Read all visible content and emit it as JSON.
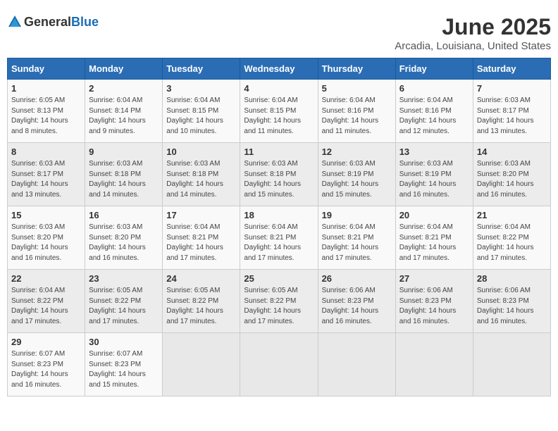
{
  "header": {
    "logo_general": "General",
    "logo_blue": "Blue",
    "main_title": "June 2025",
    "subtitle": "Arcadia, Louisiana, United States"
  },
  "calendar": {
    "columns": [
      "Sunday",
      "Monday",
      "Tuesday",
      "Wednesday",
      "Thursday",
      "Friday",
      "Saturday"
    ],
    "rows": [
      [
        {
          "day": "1",
          "info": "Sunrise: 6:05 AM\nSunset: 8:13 PM\nDaylight: 14 hours\nand 8 minutes."
        },
        {
          "day": "2",
          "info": "Sunrise: 6:04 AM\nSunset: 8:14 PM\nDaylight: 14 hours\nand 9 minutes."
        },
        {
          "day": "3",
          "info": "Sunrise: 6:04 AM\nSunset: 8:15 PM\nDaylight: 14 hours\nand 10 minutes."
        },
        {
          "day": "4",
          "info": "Sunrise: 6:04 AM\nSunset: 8:15 PM\nDaylight: 14 hours\nand 11 minutes."
        },
        {
          "day": "5",
          "info": "Sunrise: 6:04 AM\nSunset: 8:16 PM\nDaylight: 14 hours\nand 11 minutes."
        },
        {
          "day": "6",
          "info": "Sunrise: 6:04 AM\nSunset: 8:16 PM\nDaylight: 14 hours\nand 12 minutes."
        },
        {
          "day": "7",
          "info": "Sunrise: 6:03 AM\nSunset: 8:17 PM\nDaylight: 14 hours\nand 13 minutes."
        }
      ],
      [
        {
          "day": "8",
          "info": "Sunrise: 6:03 AM\nSunset: 8:17 PM\nDaylight: 14 hours\nand 13 minutes."
        },
        {
          "day": "9",
          "info": "Sunrise: 6:03 AM\nSunset: 8:18 PM\nDaylight: 14 hours\nand 14 minutes."
        },
        {
          "day": "10",
          "info": "Sunrise: 6:03 AM\nSunset: 8:18 PM\nDaylight: 14 hours\nand 14 minutes."
        },
        {
          "day": "11",
          "info": "Sunrise: 6:03 AM\nSunset: 8:18 PM\nDaylight: 14 hours\nand 15 minutes."
        },
        {
          "day": "12",
          "info": "Sunrise: 6:03 AM\nSunset: 8:19 PM\nDaylight: 14 hours\nand 15 minutes."
        },
        {
          "day": "13",
          "info": "Sunrise: 6:03 AM\nSunset: 8:19 PM\nDaylight: 14 hours\nand 16 minutes."
        },
        {
          "day": "14",
          "info": "Sunrise: 6:03 AM\nSunset: 8:20 PM\nDaylight: 14 hours\nand 16 minutes."
        }
      ],
      [
        {
          "day": "15",
          "info": "Sunrise: 6:03 AM\nSunset: 8:20 PM\nDaylight: 14 hours\nand 16 minutes."
        },
        {
          "day": "16",
          "info": "Sunrise: 6:03 AM\nSunset: 8:20 PM\nDaylight: 14 hours\nand 16 minutes."
        },
        {
          "day": "17",
          "info": "Sunrise: 6:04 AM\nSunset: 8:21 PM\nDaylight: 14 hours\nand 17 minutes."
        },
        {
          "day": "18",
          "info": "Sunrise: 6:04 AM\nSunset: 8:21 PM\nDaylight: 14 hours\nand 17 minutes."
        },
        {
          "day": "19",
          "info": "Sunrise: 6:04 AM\nSunset: 8:21 PM\nDaylight: 14 hours\nand 17 minutes."
        },
        {
          "day": "20",
          "info": "Sunrise: 6:04 AM\nSunset: 8:21 PM\nDaylight: 14 hours\nand 17 minutes."
        },
        {
          "day": "21",
          "info": "Sunrise: 6:04 AM\nSunset: 8:22 PM\nDaylight: 14 hours\nand 17 minutes."
        }
      ],
      [
        {
          "day": "22",
          "info": "Sunrise: 6:04 AM\nSunset: 8:22 PM\nDaylight: 14 hours\nand 17 minutes."
        },
        {
          "day": "23",
          "info": "Sunrise: 6:05 AM\nSunset: 8:22 PM\nDaylight: 14 hours\nand 17 minutes."
        },
        {
          "day": "24",
          "info": "Sunrise: 6:05 AM\nSunset: 8:22 PM\nDaylight: 14 hours\nand 17 minutes."
        },
        {
          "day": "25",
          "info": "Sunrise: 6:05 AM\nSunset: 8:22 PM\nDaylight: 14 hours\nand 17 minutes."
        },
        {
          "day": "26",
          "info": "Sunrise: 6:06 AM\nSunset: 8:23 PM\nDaylight: 14 hours\nand 16 minutes."
        },
        {
          "day": "27",
          "info": "Sunrise: 6:06 AM\nSunset: 8:23 PM\nDaylight: 14 hours\nand 16 minutes."
        },
        {
          "day": "28",
          "info": "Sunrise: 6:06 AM\nSunset: 8:23 PM\nDaylight: 14 hours\nand 16 minutes."
        }
      ],
      [
        {
          "day": "29",
          "info": "Sunrise: 6:07 AM\nSunset: 8:23 PM\nDaylight: 14 hours\nand 16 minutes."
        },
        {
          "day": "30",
          "info": "Sunrise: 6:07 AM\nSunset: 8:23 PM\nDaylight: 14 hours\nand 15 minutes."
        },
        {
          "day": "",
          "info": ""
        },
        {
          "day": "",
          "info": ""
        },
        {
          "day": "",
          "info": ""
        },
        {
          "day": "",
          "info": ""
        },
        {
          "day": "",
          "info": ""
        }
      ]
    ]
  }
}
